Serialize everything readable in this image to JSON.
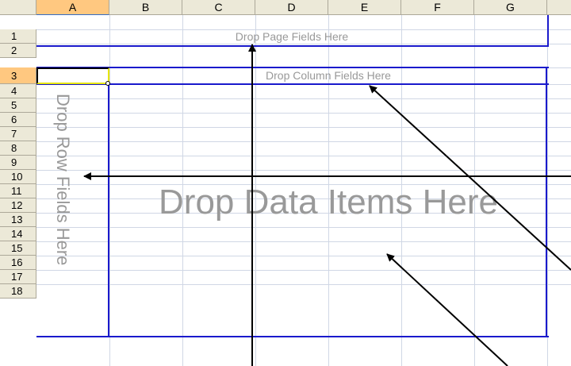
{
  "columns": [
    "A",
    "B",
    "C",
    "D",
    "E",
    "F",
    "G"
  ],
  "rows": [
    "1",
    "2",
    "3",
    "4",
    "5",
    "6",
    "7",
    "8",
    "9",
    "10",
    "11",
    "12",
    "13",
    "14",
    "15",
    "16",
    "17",
    "18"
  ],
  "selected_column": "A",
  "selected_row": "3",
  "pivot": {
    "page_fields_label": "Drop Page Fields Here",
    "column_fields_label": "Drop Column Fields Here",
    "row_fields_label": "Drop Row Fields Here",
    "data_items_label": "Drop Data Items Here"
  },
  "colors": {
    "zone_border": "#1a1acc",
    "zone_text": "#999999",
    "header_bg": "#ece9d8",
    "header_selected_bg": "#ffc880",
    "active_cell_border": "#e6e600"
  }
}
